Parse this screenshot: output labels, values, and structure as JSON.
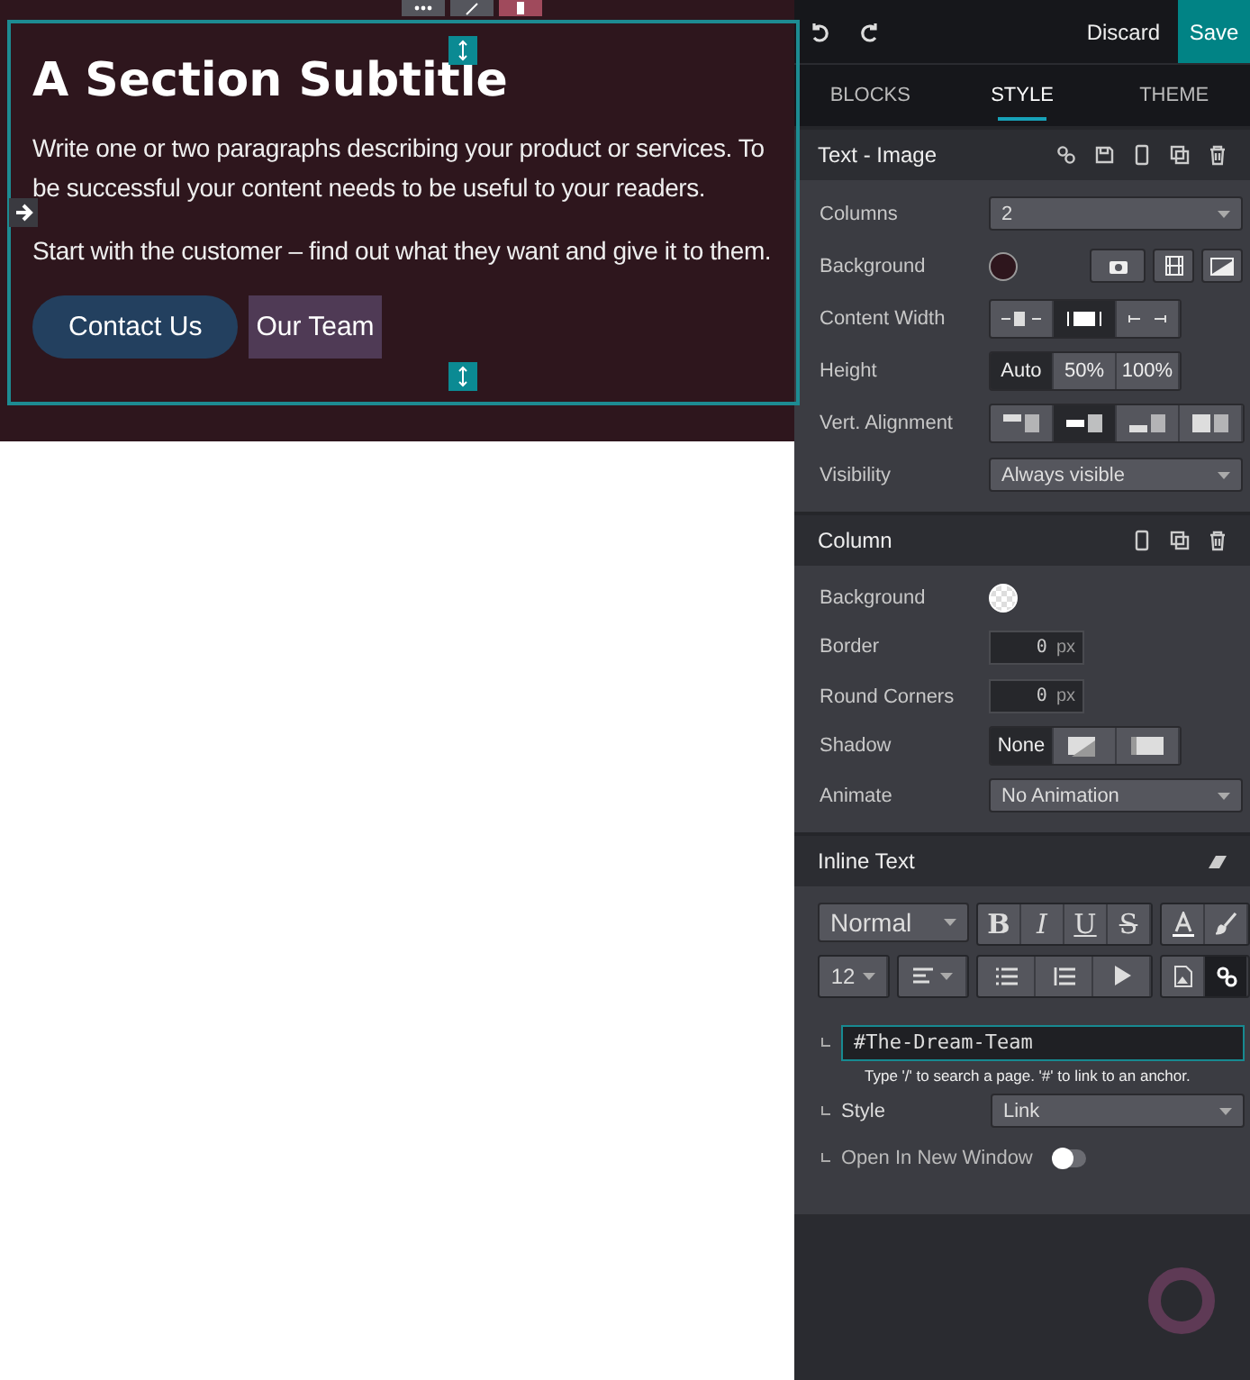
{
  "section": {
    "title": "A Section Subtitle",
    "paragraphs": [
      "Write one or two paragraphs describing your product or services. To be successful your content needs to be useful to your readers.",
      "Start with the customer – find out what they want and give it to them."
    ],
    "buttons": [
      {
        "label": "Contact Us",
        "kind": "primary",
        "selected": false
      },
      {
        "label": "Our Team",
        "kind": "link",
        "selected": true
      }
    ]
  },
  "topbar": {
    "discard": "Discard",
    "save": "Save"
  },
  "tabs": [
    {
      "label": "BLOCKS",
      "selected": false
    },
    {
      "label": "STYLE",
      "selected": true
    },
    {
      "label": "THEME",
      "selected": false
    }
  ],
  "panels": [
    {
      "title": "Text - Image",
      "kind": "block",
      "rows": [
        {
          "label": "Columns",
          "kind": "select",
          "value": "2"
        },
        {
          "label": "Background",
          "kind": "swatch",
          "color": "#2e161d"
        },
        {
          "label": "Content Width",
          "kind": "width",
          "options": [
            {
              "selected": false
            },
            {
              "selected": true
            },
            {
              "selected": false
            }
          ]
        },
        {
          "label": "Height",
          "kind": "text-segments",
          "options": [
            {
              "label": "Auto",
              "selected": true
            },
            {
              "label": "50%",
              "selected": false
            },
            {
              "label": "100%",
              "selected": false
            }
          ]
        },
        {
          "label": "Vert. Alignment",
          "kind": "valign",
          "options": [
            {
              "selected": false
            },
            {
              "selected": true
            },
            {
              "selected": false
            },
            {
              "selected": false
            }
          ]
        },
        {
          "label": "Visibility",
          "kind": "select",
          "value": "Always visible"
        }
      ]
    },
    {
      "title": "Column",
      "kind": "column",
      "rows": [
        {
          "label": "Background",
          "kind": "checker"
        },
        {
          "label": "Border",
          "kind": "number",
          "value": "0",
          "unit": "px"
        },
        {
          "label": "Round Corners",
          "kind": "number",
          "value": "0",
          "unit": "px"
        },
        {
          "label": "Shadow",
          "kind": "shadow",
          "options": [
            {
              "label": "None",
              "selected": true
            },
            {
              "selected": false
            },
            {
              "selected": false
            }
          ]
        },
        {
          "label": "Animate",
          "kind": "select",
          "value": "No Animation"
        }
      ]
    }
  ],
  "inline": {
    "title": "Inline Text",
    "format": "Normal",
    "marks": [
      {
        "label": "B",
        "kind": "bold"
      },
      {
        "label": "I",
        "kind": "italic"
      },
      {
        "label": "U",
        "kind": "underline"
      },
      {
        "label": "S",
        "kind": "strike"
      }
    ],
    "size": "12",
    "link_selected": true,
    "link": {
      "value": "#The-Dream-Team",
      "hint": "Type '/' to search a page. '#' to link to an anchor."
    },
    "style": {
      "label": "Style",
      "value": "Link"
    },
    "new_window": {
      "label": "Open In New Window",
      "on": false
    }
  }
}
